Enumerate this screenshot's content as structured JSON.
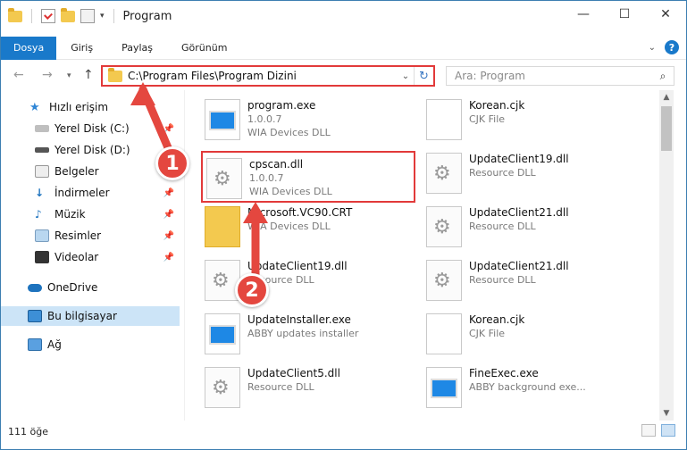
{
  "window": {
    "title": "Program",
    "controls": {
      "minimize": "—",
      "maximize": "☐",
      "close": "✕"
    }
  },
  "ribbon": {
    "tabs": [
      "Dosya",
      "Giriş",
      "Paylaş",
      "Görünüm"
    ],
    "help": "?"
  },
  "address": {
    "path": "C:\\Program Files\\Program Dizini",
    "search_placeholder": "Ara: Program"
  },
  "sidebar": {
    "items": [
      {
        "label": "Hızlı erişim",
        "icon": "star-icon"
      },
      {
        "label": "Yerel Disk (C:)",
        "icon": "drive-icon"
      },
      {
        "label": "Yerel Disk (D:)",
        "icon": "drive-icon"
      },
      {
        "label": "Belgeler",
        "icon": "documents-icon"
      },
      {
        "label": "İndirmeler",
        "icon": "download-icon"
      },
      {
        "label": "Müzik",
        "icon": "music-icon"
      },
      {
        "label": "Resimler",
        "icon": "pictures-icon"
      },
      {
        "label": "Videolar",
        "icon": "videos-icon"
      },
      {
        "label": "OneDrive",
        "icon": "cloud-icon"
      },
      {
        "label": "Bu bilgisayar",
        "icon": "computer-icon"
      },
      {
        "label": "Ağ",
        "icon": "network-icon"
      }
    ]
  },
  "files": {
    "left": [
      {
        "name": "program.exe",
        "sub1": "1.0.0.7",
        "sub2": "WIA Devices DLL",
        "type": "exe"
      },
      {
        "name": "cpscan.dll",
        "sub1": "1.0.0.7",
        "sub2": "WIA Devices DLL",
        "type": "dll"
      },
      {
        "name": "Microsoft.VC90.CRT",
        "sub1": "",
        "sub2": "WIA Devices DLL",
        "type": "folder"
      },
      {
        "name": "UpdateClient19.dll",
        "sub1": "Resource DLL",
        "sub2": "",
        "type": "dll"
      },
      {
        "name": "UpdateInstaller.exe",
        "sub1": "ABBY updates installer",
        "sub2": "",
        "type": "exe"
      },
      {
        "name": "UpdateClient5.dll",
        "sub1": "Resource DLL",
        "sub2": "",
        "type": "dll"
      }
    ],
    "right": [
      {
        "name": "Korean.cjk",
        "sub1": "CJK File",
        "type": "doc"
      },
      {
        "name": "UpdateClient19.dll",
        "sub1": "Resource DLL",
        "type": "dll"
      },
      {
        "name": "UpdateClient21.dll",
        "sub1": "Resource DLL",
        "type": "dll"
      },
      {
        "name": "UpdateClient21.dll",
        "sub1": "Resource DLL",
        "type": "dll"
      },
      {
        "name": "Korean.cjk",
        "sub1": "CJK File",
        "type": "doc"
      },
      {
        "name": "FineExec.exe",
        "sub1": "ABBY background exe...",
        "type": "exe"
      }
    ]
  },
  "status": {
    "count": "111 öğe"
  },
  "annotations": {
    "step1": "1",
    "step2": "2"
  },
  "colors": {
    "accent": "#1979ca",
    "highlight": "#e23a3a"
  }
}
